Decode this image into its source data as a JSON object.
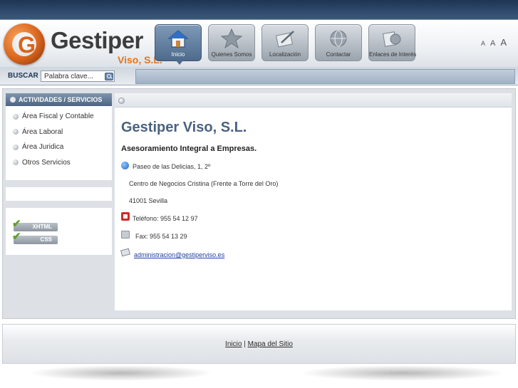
{
  "brand": {
    "logo_letter": "G",
    "name": "Gestiper",
    "subname": "Viso, S.L."
  },
  "nav": [
    {
      "label": "Inicio",
      "icon": "home-icon",
      "active": true
    },
    {
      "label": "Quienes Somos",
      "icon": "star-icon",
      "active": false
    },
    {
      "label": "Localización",
      "icon": "map-pen-icon",
      "active": false
    },
    {
      "label": "Contactar",
      "icon": "globe-icon",
      "active": false
    },
    {
      "label": "Enlaces de Interés",
      "icon": "links-icon",
      "active": false
    }
  ],
  "font_size": {
    "small": "A",
    "medium": "A",
    "large": "A"
  },
  "search": {
    "label": "BUSCAR",
    "placeholder": "Palabra clave..."
  },
  "sidebar": {
    "heading": "ACTIVIDADES / SERVICIOS",
    "items": [
      {
        "label": "Área Fiscal y Contable"
      },
      {
        "label": "Área Laboral"
      },
      {
        "label": "Área Juridica"
      },
      {
        "label": "Otros Servicios"
      }
    ],
    "badges": [
      {
        "label": "XHTML"
      },
      {
        "label": "CSS"
      }
    ]
  },
  "content": {
    "title": "Gestiper Viso, S.L.",
    "subtitle": "Asesoramiento Integral a Empresas.",
    "address_line1": "Paseo de las Delicias, 1, 2º",
    "address_line2": "Centro de Negocios Cristina (Frente a Torre del Oro)",
    "address_line3": "41001 Sevilla",
    "phone": "Teléfono: 955 54 12 97",
    "fax": "Fax:  955 54 13 29",
    "email": "administracion@gestiperviso.es"
  },
  "footer": {
    "link_home": "Inicio",
    "separator": "|",
    "link_sitemap": "Mapa del Sitio"
  },
  "colors": {
    "accent_blue": "#4a6281",
    "brand_orange": "#e0761f",
    "header_dark": "#1e3553"
  }
}
